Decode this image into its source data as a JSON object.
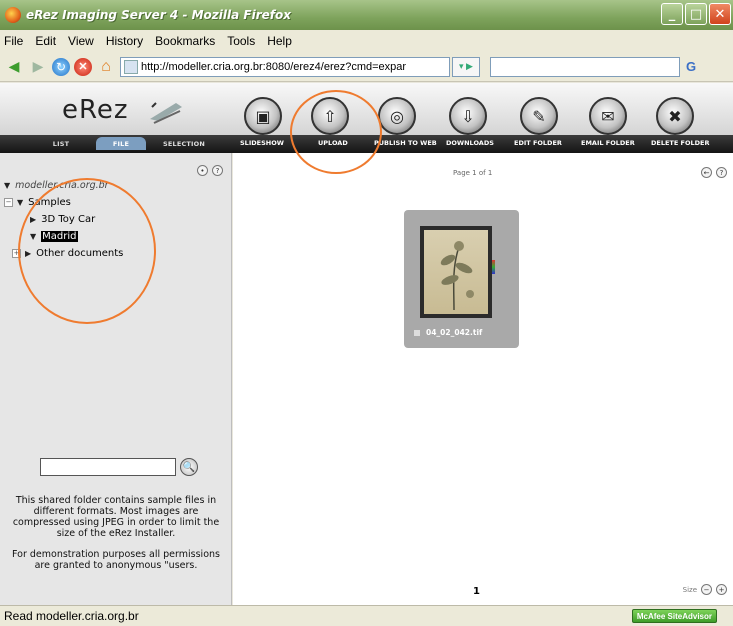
{
  "window": {
    "title": "eRez Imaging Server 4 - Mozilla Firefox"
  },
  "menu": {
    "items": [
      "File",
      "Edit",
      "View",
      "History",
      "Bookmarks",
      "Tools",
      "Help"
    ]
  },
  "nav": {
    "url": "http://modeller.cria.org.br:8080/erez4/erez?cmd=expar"
  },
  "erez": {
    "logo": "eRez",
    "tabs": [
      "LIST",
      "FILE",
      "SELECTION"
    ],
    "tools": [
      "SLIDESHOW",
      "UPLOAD",
      "PUBLISH TO WEB",
      "DOWNLOADS",
      "EDIT FOLDER",
      "EMAIL FOLDER",
      "DELETE FOLDER"
    ]
  },
  "tree": {
    "root": "modeller.cria.org.br",
    "items": [
      {
        "label": "Samples"
      },
      {
        "label": "3D Toy Car"
      },
      {
        "label": "Madrid"
      },
      {
        "label": "Other documents"
      }
    ]
  },
  "search": {
    "value": ""
  },
  "description": {
    "p1": "This shared folder contains sample files in different formats. Most images are compressed using JPEG in order to limit the size of the eRez Installer.",
    "p2": "For demonstration purposes all permissions are granted to anonymous \"users."
  },
  "main": {
    "page_info": "Page 1 of 1",
    "thumbnail_name": "04_02_042.tif",
    "page_number": "1",
    "size_label": "Size"
  },
  "status": {
    "text": "Read modeller.cria.org.br",
    "addon": "McAfee SiteAdvisor"
  },
  "colors": {
    "annotation": "#ef7b2f",
    "titlebar": "#7ea35c"
  }
}
